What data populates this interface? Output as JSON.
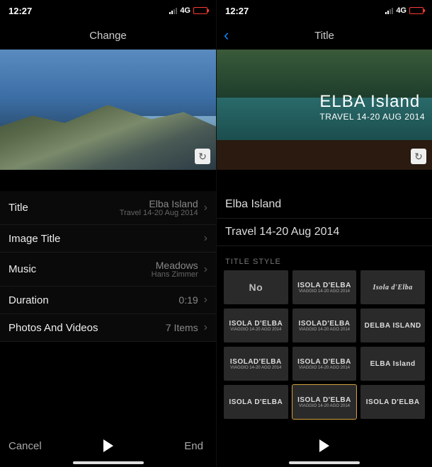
{
  "left": {
    "status": {
      "time": "12:27",
      "network": "4G"
    },
    "nav": {
      "title": "Change"
    },
    "preview_overlay": {
      "title": "",
      "subtitle": ""
    },
    "rows": {
      "title": {
        "label": "Title",
        "value": "Elba Island",
        "sub": "Travel 14-20 Aug 2014"
      },
      "image_title": {
        "label": "Image Title",
        "value": ""
      },
      "music": {
        "label": "Music",
        "value": "Meadows",
        "sub": "Hans Zimmer"
      },
      "duration": {
        "label": "Duration",
        "value": "0:19"
      },
      "media": {
        "label": "Photos And Videos",
        "value": "7 Items"
      }
    },
    "bottom": {
      "cancel": "Cancel",
      "end": "End"
    }
  },
  "right": {
    "status": {
      "time": "12:27",
      "network": "4G"
    },
    "nav": {
      "title": "Title"
    },
    "preview_overlay": {
      "title": "ELBA Island",
      "subtitle": "TRAVEL 14-20 AUG 2014"
    },
    "inputs": {
      "line1": "Elba Island",
      "line2": "Travel 14-20 Aug 2014"
    },
    "section": "TITLE STYLE",
    "styles": [
      {
        "t": "No",
        "s": "",
        "cls": "none"
      },
      {
        "t": "ISOLA D'ELBA",
        "s": "VIAGGIO 14-20 AGO 2014",
        "cls": ""
      },
      {
        "t": "Isola d'Elba",
        "s": "",
        "cls": "serif"
      },
      {
        "t": "ISOLA D'ELBA",
        "s": "VIAGGIO 14-20 AGO 2014",
        "cls": ""
      },
      {
        "t": "ISOLAD'ELBA",
        "s": "VIAGGIO 14-20 AGO 2014",
        "cls": ""
      },
      {
        "t": "DELBA ISLAND",
        "s": "",
        "cls": ""
      },
      {
        "t": "ISOLAD'ELBA",
        "s": "VIAGGIO 14-20 AGO 2014",
        "cls": ""
      },
      {
        "t": "ISOLA D'ELBA",
        "s": "VIAGGIO 14-20 AGO 2014",
        "cls": ""
      },
      {
        "t": "ELBA Island",
        "s": "",
        "cls": ""
      },
      {
        "t": "ISOLA D'ELBA",
        "s": "",
        "cls": ""
      },
      {
        "t": "ISOLA D'ELBA",
        "s": "VIAGGIO 14-20 AGO 2014",
        "cls": "sel"
      },
      {
        "t": "ISOLA D'ELBA",
        "s": "",
        "cls": ""
      }
    ]
  }
}
